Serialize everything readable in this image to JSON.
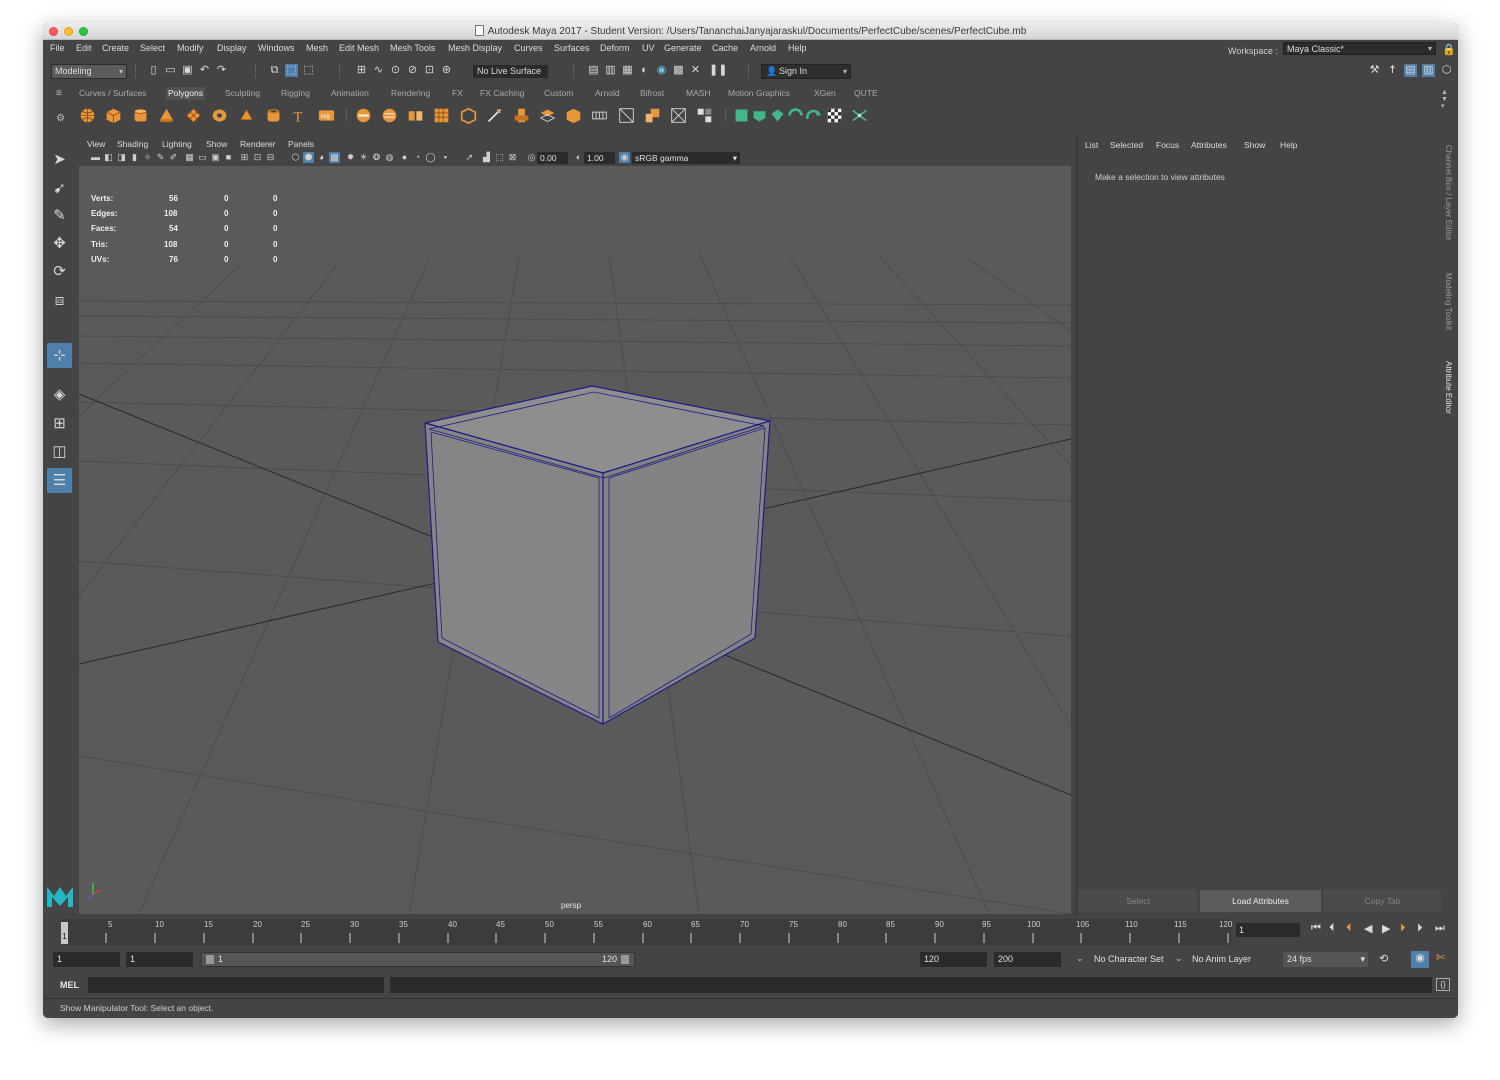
{
  "window": {
    "title": "Autodesk Maya 2017 - Student Version: /Users/TananchaiJanyajaraskul/Documents/PerfectCube/scenes/PerfectCube.mb"
  },
  "menubar": {
    "items": [
      "File",
      "Edit",
      "Create",
      "Select",
      "Modify",
      "Display",
      "Windows",
      "Mesh",
      "Edit Mesh",
      "Mesh Tools",
      "Mesh Display",
      "Curves",
      "Surfaces",
      "Deform",
      "UV",
      "Generate",
      "Cache",
      "Arnold",
      "Help"
    ],
    "workspace_label": "Workspace :",
    "workspace_value": "Maya Classic*"
  },
  "statusline": {
    "mode": "Modeling",
    "live_surface": "No Live Surface",
    "sign_in": "Sign In"
  },
  "shelf": {
    "tabs": [
      "Curves / Surfaces",
      "Polygons",
      "Sculpting",
      "Rigging",
      "Animation",
      "Rendering",
      "FX",
      "FX Caching",
      "Custom",
      "Arnold",
      "Bifrost",
      "MASH",
      "Motion Graphics",
      "XGen",
      "QUTE"
    ],
    "active_tab": "Polygons"
  },
  "viewport": {
    "menu": [
      "View",
      "Shading",
      "Lighting",
      "Show",
      "Renderer",
      "Panels"
    ],
    "exposure": "0.00",
    "gamma": "1.00",
    "colorspace": "sRGB gamma",
    "camera": "persp",
    "hud": [
      [
        "Verts:",
        "56",
        "0",
        "0"
      ],
      [
        "Edges:",
        "108",
        "0",
        "0"
      ],
      [
        "Faces:",
        "54",
        "0",
        "0"
      ],
      [
        "Tris:",
        "108",
        "0",
        "0"
      ],
      [
        "UVs:",
        "76",
        "0",
        "0"
      ]
    ]
  },
  "channel_box": {
    "menu": [
      "List",
      "Selected",
      "Focus",
      "Attributes",
      "Show",
      "Help"
    ],
    "hint": "Make a selection to view attributes",
    "buttons": [
      "Select",
      "Load Attributes",
      "Copy Tab"
    ],
    "side_tabs": [
      "Channel Box / Layer Editor",
      "Modeling Toolkit",
      "Attribute Editor"
    ]
  },
  "timeline": {
    "ticks": [
      "5",
      "10",
      "15",
      "20",
      "25",
      "30",
      "35",
      "40",
      "45",
      "50",
      "55",
      "60",
      "65",
      "70",
      "75",
      "80",
      "85",
      "90",
      "95",
      "100",
      "105",
      "110",
      "115",
      "120"
    ],
    "start_marker": "1",
    "current_frame": "1"
  },
  "range": {
    "start": "1",
    "anim_start": "1",
    "slider_start": "1",
    "slider_end": "120",
    "anim_end": "120",
    "end": "200",
    "character_set": "No Character Set",
    "anim_layer": "No Anim Layer",
    "fps": "24 fps"
  },
  "command": {
    "lang": "MEL"
  },
  "help": {
    "text": "Show Manipulator Tool: Select an object."
  },
  "colors": {
    "accent_blue": "#4f7fab",
    "shelf_orange": "#e8963a",
    "shelf_green": "#41b88a",
    "cube_face": "#8b8b8b",
    "cube_edge": "#1d1d86"
  }
}
